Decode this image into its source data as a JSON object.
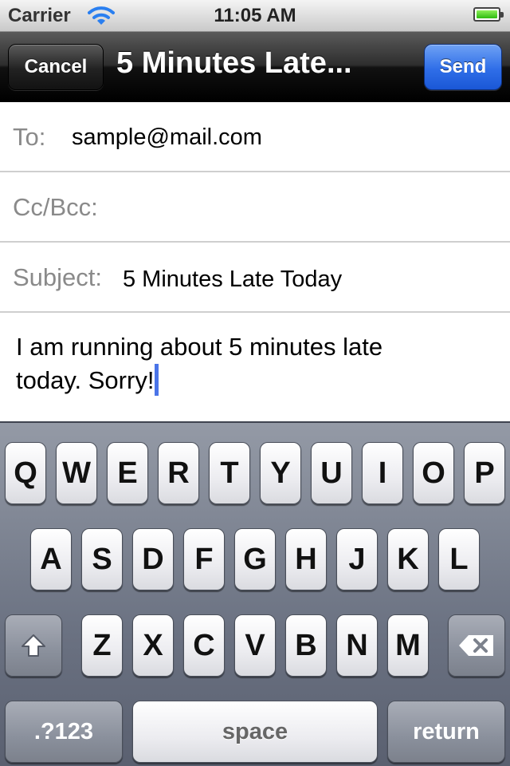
{
  "status_bar": {
    "carrier": "Carrier",
    "time": "11:05 AM",
    "wifi_icon": "wifi-icon",
    "battery_icon": "battery-icon"
  },
  "nav": {
    "cancel_label": "Cancel",
    "title": "5 Minutes Late...",
    "send_label": "Send"
  },
  "fields": {
    "to_label": "To:",
    "to_value": "sample@mail.com",
    "cc_label": "Cc/Bcc:",
    "cc_value": "",
    "subject_label": "Subject:",
    "subject_value": "5 Minutes Late Today"
  },
  "body": {
    "line1": "I am running about 5 minutes late",
    "line2": "today. Sorry!"
  },
  "keyboard": {
    "row1": [
      "Q",
      "W",
      "E",
      "R",
      "T",
      "Y",
      "U",
      "I",
      "O",
      "P"
    ],
    "row2": [
      "A",
      "S",
      "D",
      "F",
      "G",
      "H",
      "J",
      "K",
      "L"
    ],
    "row3": [
      "Z",
      "X",
      "C",
      "V",
      "B",
      "N",
      "M"
    ],
    "shift_icon": "shift-icon",
    "backspace_icon": "backspace-icon",
    "numbers_label": ".?123",
    "space_label": "space",
    "return_label": "return"
  },
  "colors": {
    "send_button": "#2f6ee8",
    "cursor": "#4a74e8"
  }
}
